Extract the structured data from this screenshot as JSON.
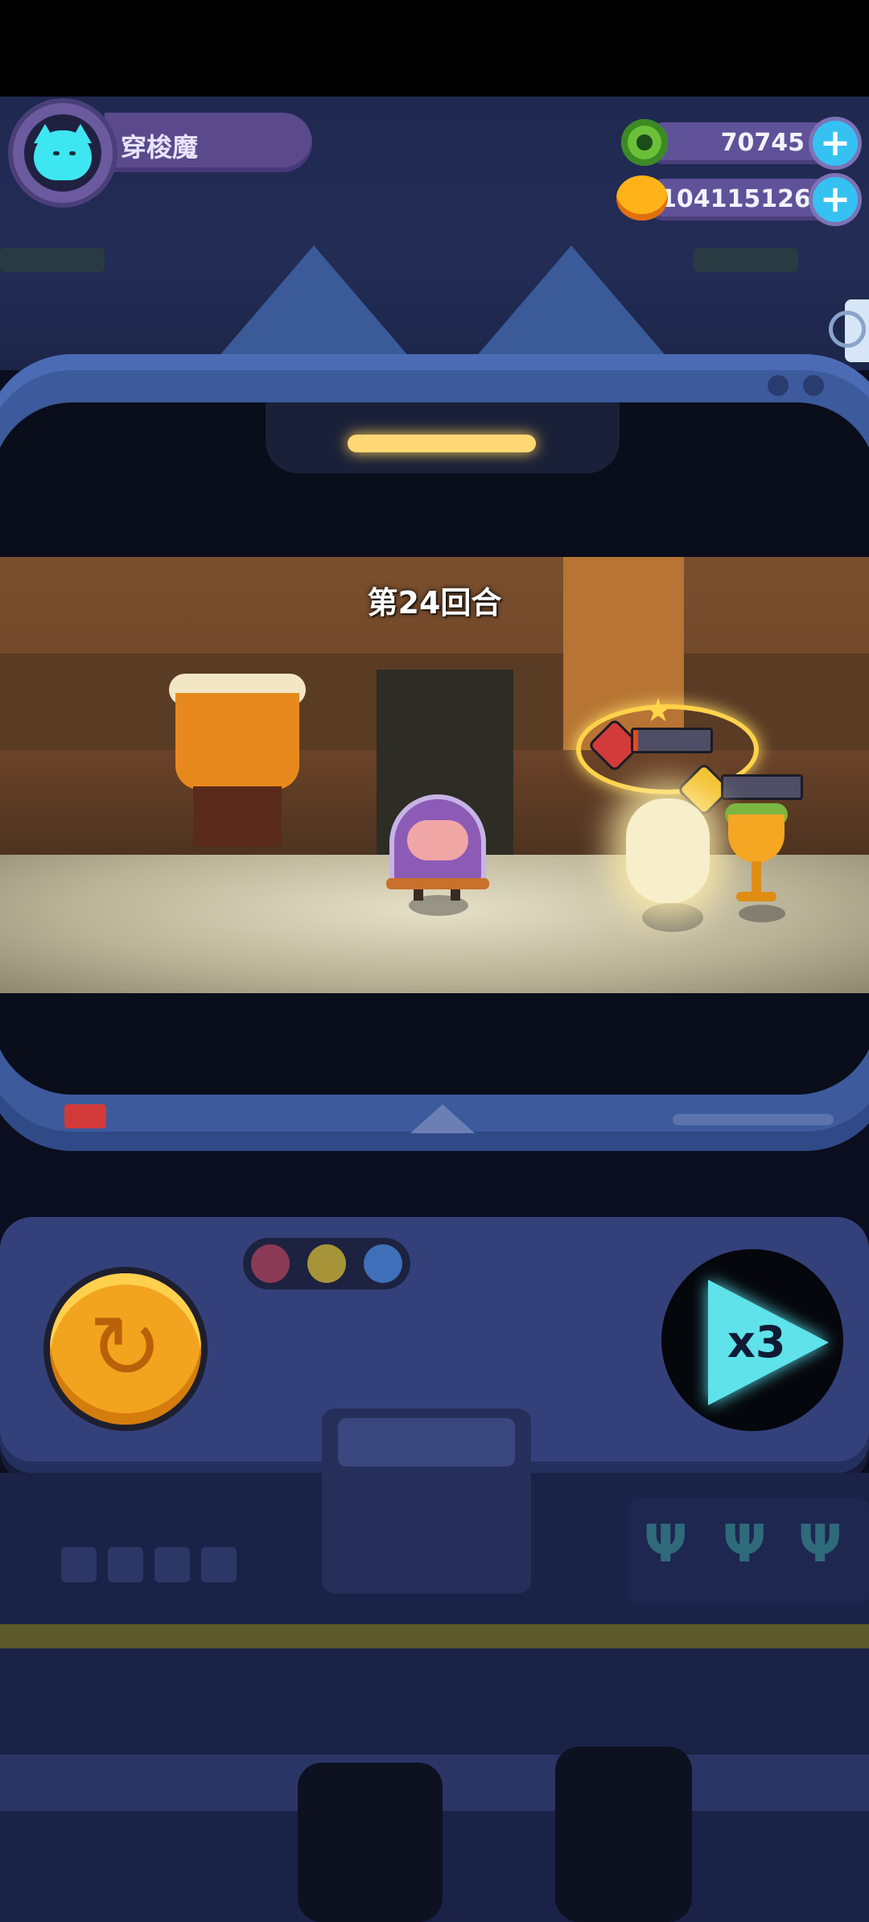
{
  "profile": {
    "name": "穿梭魔",
    "avatar_icon": "cat-face-icon"
  },
  "currencies": [
    {
      "icon": "green-gem-coin-icon",
      "value": "70745",
      "add_label": "+"
    },
    {
      "icon": "orange-planet-coin-icon",
      "value": "104115126",
      "add_label": "+"
    }
  ],
  "battle": {
    "round_label": "第24回合",
    "boss_hp_fraction": 0.06,
    "enemy2_hp_fraction": 0.0
  },
  "controls": {
    "replay_icon": "replay-icon",
    "speed_label": "x3",
    "indicator_colors": [
      "#8b3a55",
      "#a89438",
      "#3f6fb8"
    ]
  },
  "colors": {
    "accent_cyan": "#5fe2ea",
    "replay_orange": "#f2a41e",
    "panel": "#34407a"
  }
}
